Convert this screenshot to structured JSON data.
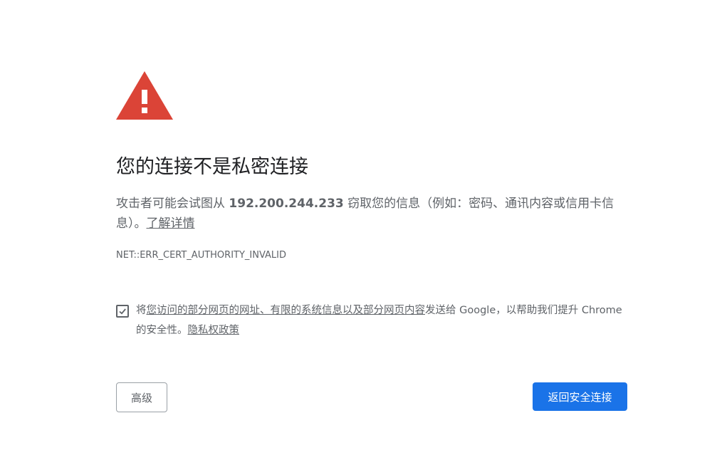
{
  "icon": {
    "name": "warning-triangle-icon",
    "color": "#db4437"
  },
  "heading": "您的连接不是私密连接",
  "explanation": {
    "prefix": "攻击者可能会试图从 ",
    "host": "192.200.244.233",
    "suffix": " 窃取您的信息（例如：密码、通讯内容或信用卡信息）。",
    "learn_more": "了解详情"
  },
  "error_code": "NET::ERR_CERT_AUTHORITY_INVALID",
  "optin": {
    "checked": true,
    "prefix": "将",
    "link1": "您访问的部分网页的网址、有限的系统信息以及部分网页内容",
    "middle": "发送给 Google，以帮助我们提升 Chrome 的安全性。",
    "privacy_link": "隐私权政策"
  },
  "buttons": {
    "advanced": "高级",
    "back_to_safety": "返回安全连接"
  },
  "colors": {
    "primary_button": "#1a73e8",
    "text_secondary": "#5f6368",
    "heading_text": "#202124"
  }
}
